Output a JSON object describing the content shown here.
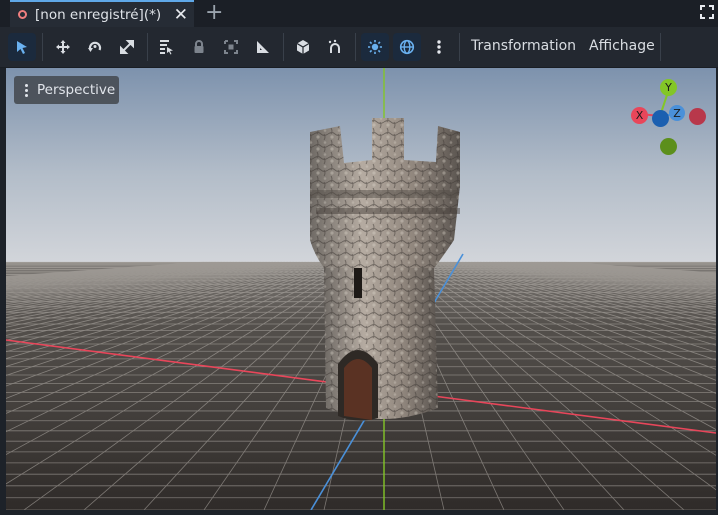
{
  "tab": {
    "title": "[non enregistré](*)",
    "close_glyph": "✕",
    "add_glyph": "+"
  },
  "toolbar": {
    "icons": [
      "select-icon",
      "move-icon",
      "rotate-icon",
      "scale-icon",
      "list-select-icon",
      "lock-icon",
      "group-icon",
      "ruler-icon",
      "camera-icon",
      "pivot-icon",
      "sun-icon",
      "environment-icon",
      "more-icon"
    ],
    "transform_menu": "Transformation",
    "view_menu": "Affichage"
  },
  "viewport": {
    "perspective_label": "Perspective",
    "gizmo": {
      "y_label": "Y",
      "x_label": "X",
      "z_label": "Z"
    }
  },
  "colors": {
    "accent": "#5fa8e8",
    "axis_x": "#e8465a",
    "axis_y": "#83c627",
    "axis_z": "#4a90d9",
    "tab_dot": "#f07f7f"
  }
}
